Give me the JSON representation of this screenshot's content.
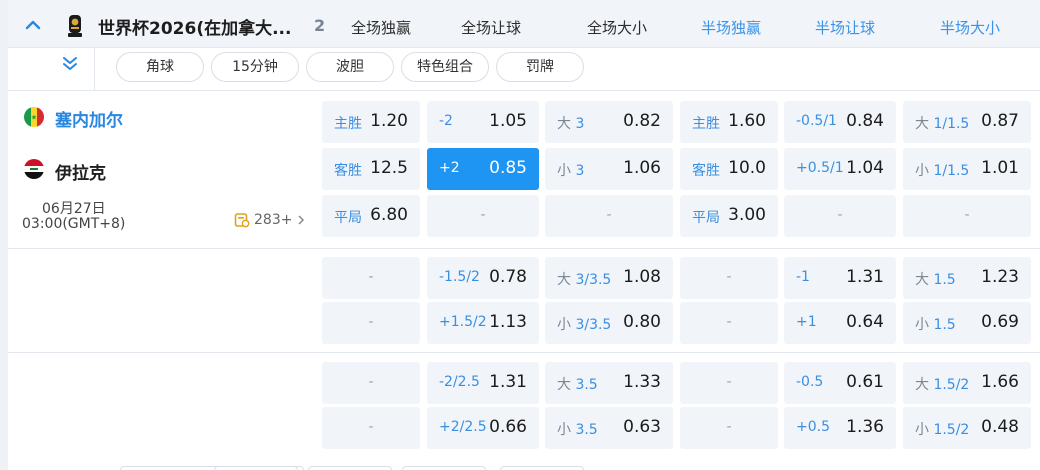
{
  "header": {
    "league_name": "世界杯2026(在加拿大...",
    "match_count": "2",
    "columns": [
      "全场独赢",
      "全场让球",
      "全场大小",
      "半场独赢",
      "半场让球",
      "半场大小"
    ]
  },
  "filters": [
    "角球",
    "15分钟",
    "波胆",
    "特色组合",
    "罚牌"
  ],
  "match": {
    "home": "塞内加尔",
    "away": "伊拉克",
    "date": "06月27日",
    "time": "03:00(GMT+8)",
    "more_markets": "283+"
  },
  "odds_rows": [
    [
      {
        "label": "主胜",
        "odd": "1.20",
        "lc": "blue"
      },
      {
        "label": "-2",
        "odd": "1.05",
        "lc": "blue"
      },
      {
        "label": "大 3",
        "odd": "0.82",
        "lc": "split"
      },
      {
        "label": "主胜",
        "odd": "1.60",
        "lc": "blue"
      },
      {
        "label": "-0.5/1",
        "odd": "0.84",
        "lc": "blue"
      },
      {
        "label": "大 1/1.5",
        "odd": "0.87",
        "lc": "split"
      }
    ],
    [
      {
        "label": "客胜",
        "odd": "12.5",
        "lc": "blue"
      },
      {
        "label": "+2",
        "odd": "0.85",
        "lc": "blue",
        "selected": true
      },
      {
        "label": "小 3",
        "odd": "1.06",
        "lc": "split"
      },
      {
        "label": "客胜",
        "odd": "10.0",
        "lc": "blue"
      },
      {
        "label": "+0.5/1",
        "odd": "1.04",
        "lc": "blue"
      },
      {
        "label": "小 1/1.5",
        "odd": "1.01",
        "lc": "split"
      }
    ],
    [
      {
        "label": "平局",
        "odd": "6.80",
        "lc": "blue"
      },
      {
        "dash": "-"
      },
      {
        "dash": "-"
      },
      {
        "label": "平局",
        "odd": "3.00",
        "lc": "blue"
      },
      {
        "dash": "-"
      },
      {
        "dash": "-"
      }
    ],
    [
      {
        "dash": "-"
      },
      {
        "label": "-1.5/2",
        "odd": "0.78",
        "lc": "blue"
      },
      {
        "label": "大 3/3.5",
        "odd": "1.08",
        "lc": "split"
      },
      {
        "dash": "-"
      },
      {
        "label": "-1",
        "odd": "1.31",
        "lc": "blue"
      },
      {
        "label": "大 1.5",
        "odd": "1.23",
        "lc": "split"
      }
    ],
    [
      {
        "dash": "-"
      },
      {
        "label": "+1.5/2",
        "odd": "1.13",
        "lc": "blue"
      },
      {
        "label": "小 3/3.5",
        "odd": "0.80",
        "lc": "split"
      },
      {
        "dash": "-"
      },
      {
        "label": "+1",
        "odd": "0.64",
        "lc": "blue"
      },
      {
        "label": "小 1.5",
        "odd": "0.69",
        "lc": "split"
      }
    ],
    [
      {
        "dash": "-"
      },
      {
        "label": "-2/2.5",
        "odd": "1.31",
        "lc": "blue"
      },
      {
        "label": "大 3.5",
        "odd": "1.33",
        "lc": "split"
      },
      {
        "dash": "-"
      },
      {
        "label": "-0.5",
        "odd": "0.61",
        "lc": "blue"
      },
      {
        "label": "大 1.5/2",
        "odd": "1.66",
        "lc": "split"
      }
    ],
    [
      {
        "dash": "-"
      },
      {
        "label": "+2/2.5",
        "odd": "0.66",
        "lc": "blue"
      },
      {
        "label": "小 3.5",
        "odd": "0.63",
        "lc": "split"
      },
      {
        "dash": "-"
      },
      {
        "label": "+0.5",
        "odd": "1.36",
        "lc": "blue"
      },
      {
        "label": "小 1.5/2",
        "odd": "0.48",
        "lc": "split"
      }
    ]
  ],
  "colors": {
    "accent": "#3a8fe0",
    "selected": "#1e95f3",
    "cell_bg": "#f1f5fa",
    "header_bg": "#f1f4f9"
  },
  "icons": [
    "chevron-up-icon",
    "trophy-icon",
    "double-chevron-down-icon",
    "senegal-flag-icon",
    "iraq-flag-icon",
    "markets-icon",
    "chevron-right-icon"
  ]
}
